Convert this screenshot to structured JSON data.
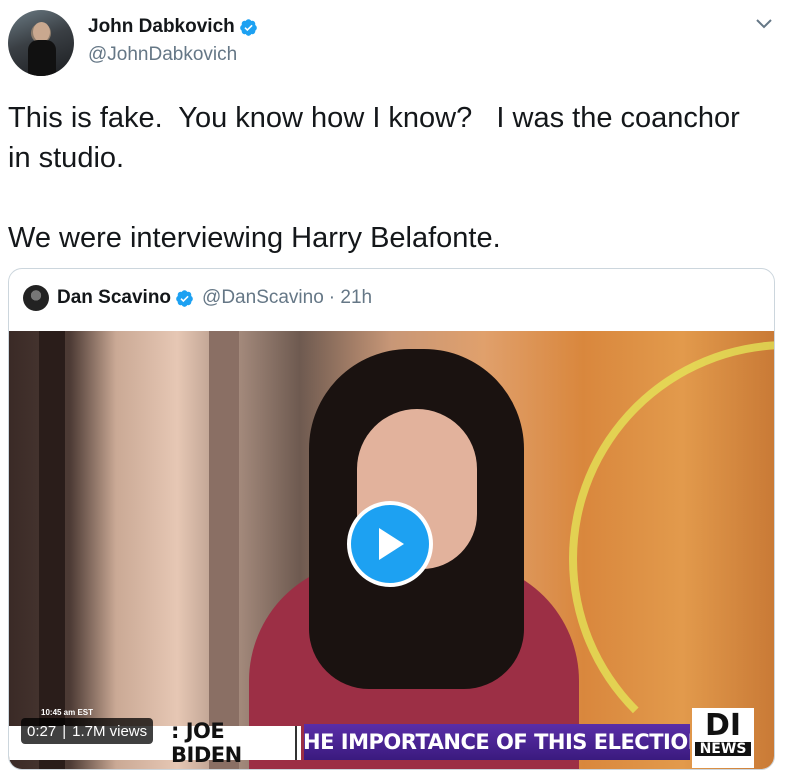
{
  "author": {
    "display_name": "John Dabkovich",
    "handle": "@JohnDabkovich",
    "verified": true
  },
  "tweet": {
    "text": "This is fake.  You know how I know?   I was the coanchor\nin studio.\n\nWe were interviewing Harry Belafonte."
  },
  "quoted_tweet": {
    "display_name": "Dan Scavino",
    "handle": "@DanScavino",
    "time": "· 21h",
    "verified": true,
    "video": {
      "duration": "0:27",
      "views": "1.7M views",
      "timestamp_overlay": "10:45 am EST",
      "ticker_left": ": JOE BIDEN",
      "ticker_main": "THE IMPORTANCE OF THIS ELECTION",
      "logo_top": "DI",
      "logo_bottom": "NEWS"
    }
  },
  "icons": {
    "more": "chevron-down-icon",
    "verified": "verified-badge-icon",
    "play": "play-icon"
  },
  "colors": {
    "accent": "#1da1f2",
    "text": "#14171a",
    "secondary": "#657786"
  }
}
